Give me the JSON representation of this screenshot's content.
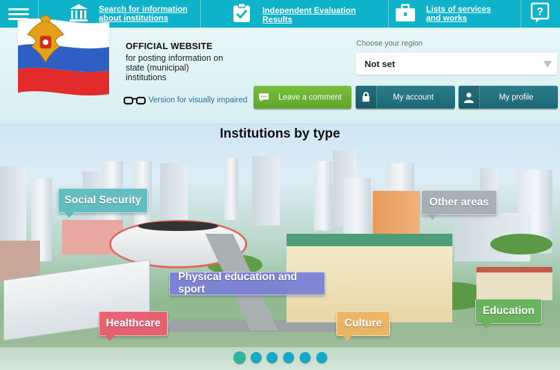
{
  "nav": {
    "search_label": "Search for information about institutions",
    "eval_label": "Independent Evaluation Results",
    "lists_label": "Lists of services and works"
  },
  "header": {
    "official_title": "OFFICIAL WEBSITE",
    "official_subtitle": "for posting information on state (municipal) institutions",
    "visually_impaired": "Version for visually impaired",
    "region_label": "Choose your region",
    "region_value": "Not set",
    "leave_comment": "Leave a comment",
    "my_account": "My account",
    "my_profile": "My profile"
  },
  "scene": {
    "title": "Institutions by type",
    "tags": {
      "social": "Social Security",
      "other": "Other areas",
      "physical": "Physical education and sport",
      "healthcare": "Healthcare",
      "culture": "Culture",
      "education": "Education"
    }
  },
  "pager": {
    "count": 6,
    "active": 1
  },
  "colors": {
    "nav": "#0fb3c9",
    "green_button": "#6ab235",
    "blue_button": "#236f7e",
    "social": "#5cbabe",
    "other": "#a5adb4",
    "physical": "#7a7fd6",
    "healthcare": "#e85c6e",
    "culture": "#ecb460",
    "education": "#68b25c"
  },
  "icons": [
    "menu-icon",
    "institution-icon",
    "checkmark-clipboard-icon",
    "briefcase-icon",
    "help-icon",
    "glasses-icon",
    "comment-icon",
    "lock-icon",
    "user-icon",
    "coat-of-arms-icon"
  ]
}
